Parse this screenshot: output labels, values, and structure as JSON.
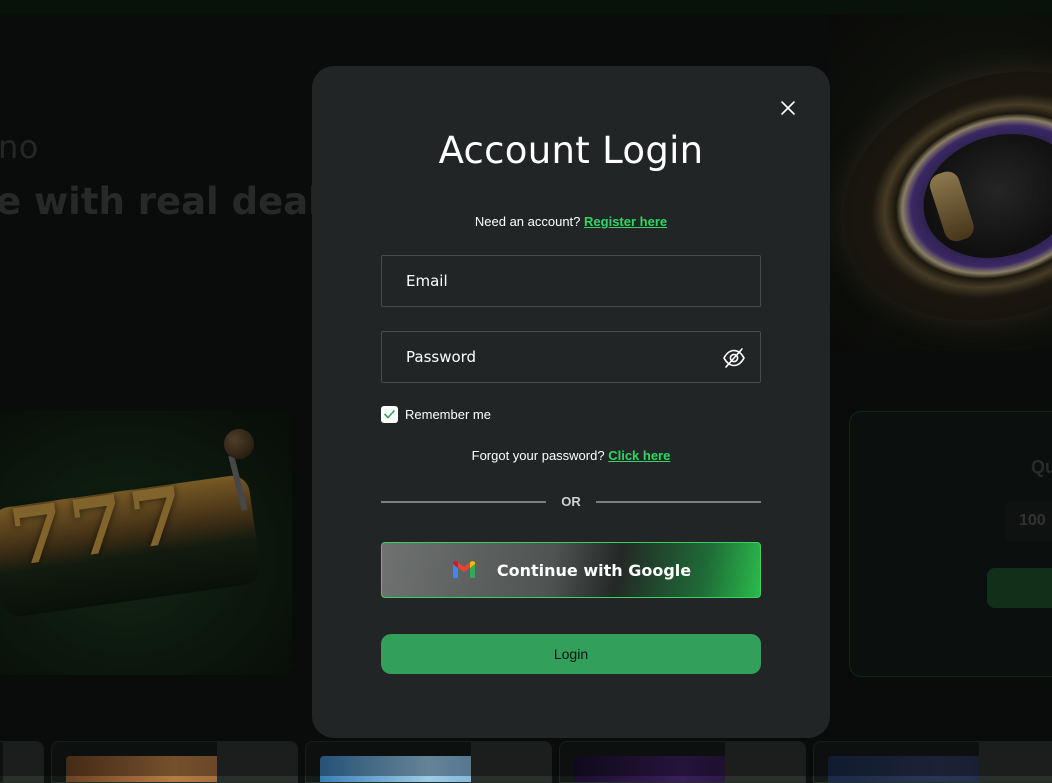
{
  "background": {
    "hero_brand": "no",
    "hero_title": "e with real dealer",
    "promo_label": "Qu",
    "promo_amount": "100"
  },
  "modal": {
    "title": "Account Login",
    "register_prompt": "Need an account?",
    "register_link": "Register here",
    "email_placeholder": "Email",
    "password_placeholder": "Password",
    "remember_label": "Remember me",
    "remember_checked": true,
    "forgot_prompt": "Forgot your password?",
    "forgot_link": "Click here",
    "divider_text": "OR",
    "google_label": "Continue with Google",
    "login_label": "Login"
  },
  "colors": {
    "accent": "#2fd666",
    "login_button": "#32a05a",
    "modal_bg": "#222526"
  },
  "icons": {
    "close": "close-icon",
    "password_toggle": "eye-off-icon",
    "google": "gmail-icon",
    "checkbox": "check-icon"
  }
}
